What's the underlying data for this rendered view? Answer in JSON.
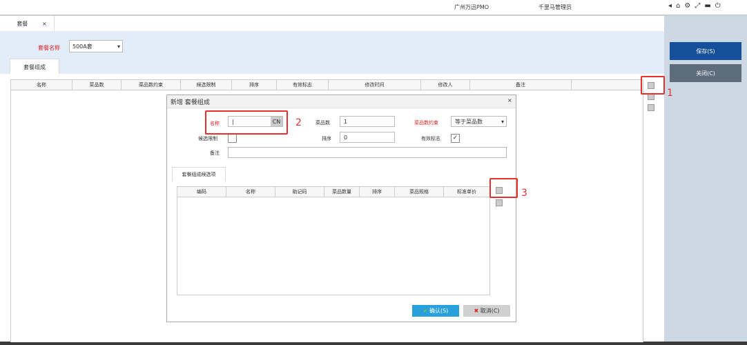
{
  "header": {
    "org": "广州万迅PMO",
    "user": "千里马管理员"
  },
  "tab": {
    "label": "套餐",
    "close": "×"
  },
  "form": {
    "name_label": "套餐名称",
    "name_value": "500A套"
  },
  "subtab": "套餐组成",
  "columns": [
    "名称",
    "菜品数",
    "菜品数约束",
    "候选限制",
    "排序",
    "有效标志",
    "修改时间",
    "修改人",
    "备注"
  ],
  "actions": {
    "save": "保存(S)",
    "close": "关闭(C)"
  },
  "dialog": {
    "title": "新增 套餐组成",
    "close": "×",
    "name_label": "名称",
    "name_value": "",
    "cn": "CN",
    "count_label": "菜品数",
    "count_value": "1",
    "constraint_label": "菜品数约束",
    "constraint_value": "等于菜品数",
    "limit_label": "候选限制",
    "sort_label": "排序",
    "sort_value": "0",
    "valid_label": "有效标志",
    "note_label": "备注",
    "subtab": "套餐组成候选项",
    "columns": [
      "编码",
      "名称",
      "助记码",
      "菜品数量",
      "排序",
      "菜品规格",
      "标准单价"
    ],
    "ok": "确认(S)",
    "cancel": "取消(C)"
  },
  "annotations": [
    "1",
    "2",
    "3"
  ]
}
